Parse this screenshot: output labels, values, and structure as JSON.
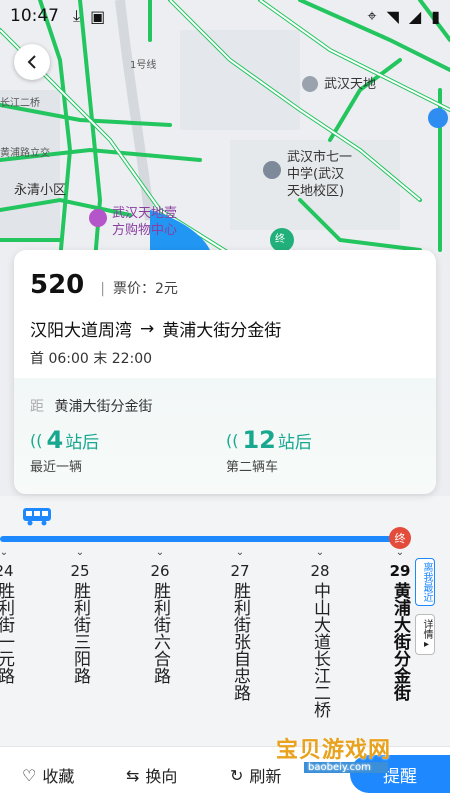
{
  "status_bar": {
    "time": "10:47"
  },
  "map": {
    "labels": {
      "metro_line": "1号线",
      "wuhan_tiandi": "武汉天地",
      "changjiang_bridge": "长江二桥",
      "huangpu_road": "黄浦路立交",
      "yongqing": "永清小区",
      "school_line1": "武汉市七一",
      "school_line2": "中学(武汉",
      "school_line3": "天地校区)",
      "mall_line1": "武汉天地壹",
      "mall_line2": "方购物中心",
      "terminal_marker": "终"
    }
  },
  "card": {
    "route_number": "520",
    "fare_sep": "|",
    "fare": "票价：2元",
    "from": "汉阳大道周湾",
    "to": "黄浦大街分金街",
    "direction_arrow": "→",
    "hours": "首 06:00 末 22:00",
    "dist_prefix": "距",
    "nearest_stop": "黄浦大街分金街",
    "arrivals": [
      {
        "num": "4",
        "unit": "站后",
        "desc": "最近一辆"
      },
      {
        "num": "12",
        "unit": "站后",
        "desc": "第二辆车"
      }
    ]
  },
  "route": {
    "end_badge": "终",
    "stops": [
      {
        "idx": "24",
        "name": "胜利街一元路",
        "final": false
      },
      {
        "idx": "25",
        "name": "胜利街三阳路",
        "final": false
      },
      {
        "idx": "26",
        "name": "胜利街六合路",
        "final": false
      },
      {
        "idx": "27",
        "name": "胜利街张自忠路",
        "final": false
      },
      {
        "idx": "28",
        "name": "中山大道长江二桥",
        "final": false
      },
      {
        "idx": "29",
        "name": "黄浦大街分金街",
        "final": true
      }
    ],
    "tag_nearest": "离我最近",
    "tag_detail": "详情▸"
  },
  "bottom_bar": {
    "favorite": "收藏",
    "reverse": "换向",
    "refresh": "刷新",
    "remind": "提醒"
  },
  "watermark": {
    "text": "宝贝游戏网",
    "url": "baobeiy.com"
  },
  "colors": {
    "accent": "#1e88ff",
    "arrival_green": "#17a88f",
    "terminal_red": "#e34c3b",
    "map_road": "#22c55e"
  }
}
